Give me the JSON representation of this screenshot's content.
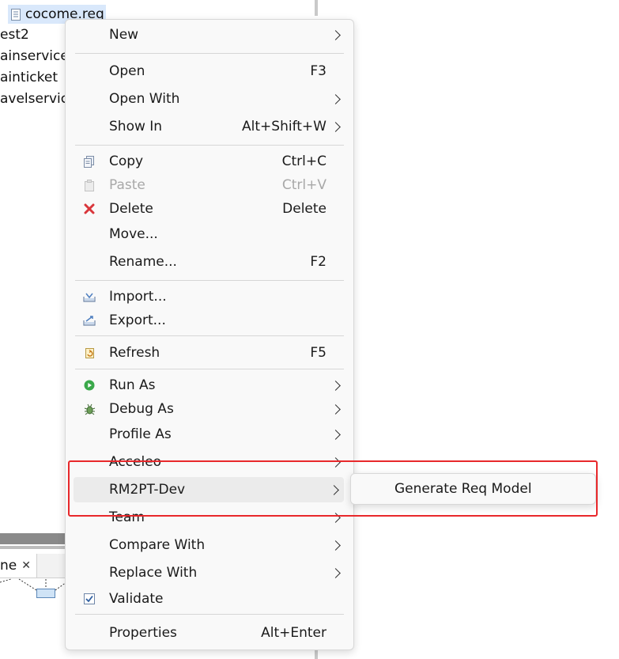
{
  "explorer": {
    "file": "cocome.req",
    "items": [
      "est2",
      "ainservice",
      "ainticket",
      "avelservic"
    ]
  },
  "bottom_panel": {
    "tab_label": "ne",
    "tab_close": "✕"
  },
  "menu": {
    "items": [
      {
        "label": "New",
        "shortcut": "",
        "submenu": true,
        "icon": ""
      },
      {
        "label": "Open",
        "shortcut": "F3",
        "submenu": false,
        "icon": ""
      },
      {
        "label": "Open With",
        "shortcut": "",
        "submenu": true,
        "icon": ""
      },
      {
        "label": "Show In",
        "shortcut": "Alt+Shift+W",
        "submenu": true,
        "icon": ""
      },
      {
        "label": "Copy",
        "shortcut": "Ctrl+C",
        "submenu": false,
        "icon": "copy-icon"
      },
      {
        "label": "Paste",
        "shortcut": "Ctrl+V",
        "submenu": false,
        "icon": "paste-icon",
        "disabled": true
      },
      {
        "label": "Delete",
        "shortcut": "Delete",
        "submenu": false,
        "icon": "delete-icon"
      },
      {
        "label": "Move...",
        "shortcut": "",
        "submenu": false,
        "icon": ""
      },
      {
        "label": "Rename...",
        "shortcut": "F2",
        "submenu": false,
        "icon": ""
      },
      {
        "label": "Import...",
        "shortcut": "",
        "submenu": false,
        "icon": "import-icon"
      },
      {
        "label": "Export...",
        "shortcut": "",
        "submenu": false,
        "icon": "export-icon"
      },
      {
        "label": "Refresh",
        "shortcut": "F5",
        "submenu": false,
        "icon": "refresh-icon"
      },
      {
        "label": "Run As",
        "shortcut": "",
        "submenu": true,
        "icon": "run-icon"
      },
      {
        "label": "Debug As",
        "shortcut": "",
        "submenu": true,
        "icon": "debug-icon"
      },
      {
        "label": "Profile As",
        "shortcut": "",
        "submenu": true,
        "icon": ""
      },
      {
        "label": "Acceleo",
        "shortcut": "",
        "submenu": true,
        "icon": ""
      },
      {
        "label": "RM2PT-Dev",
        "shortcut": "",
        "submenu": true,
        "icon": "",
        "hover": true
      },
      {
        "label": "Team",
        "shortcut": "",
        "submenu": true,
        "icon": ""
      },
      {
        "label": "Compare With",
        "shortcut": "",
        "submenu": true,
        "icon": ""
      },
      {
        "label": "Replace With",
        "shortcut": "",
        "submenu": true,
        "icon": ""
      },
      {
        "label": "Validate",
        "shortcut": "",
        "submenu": false,
        "icon": "validate-icon"
      },
      {
        "label": "Properties",
        "shortcut": "Alt+Enter",
        "submenu": false,
        "icon": ""
      }
    ]
  },
  "submenu": {
    "items": [
      {
        "label": "Generate Req Model"
      }
    ]
  },
  "colors": {
    "highlight": "#e8282b",
    "selection": "#d9e8fb"
  }
}
